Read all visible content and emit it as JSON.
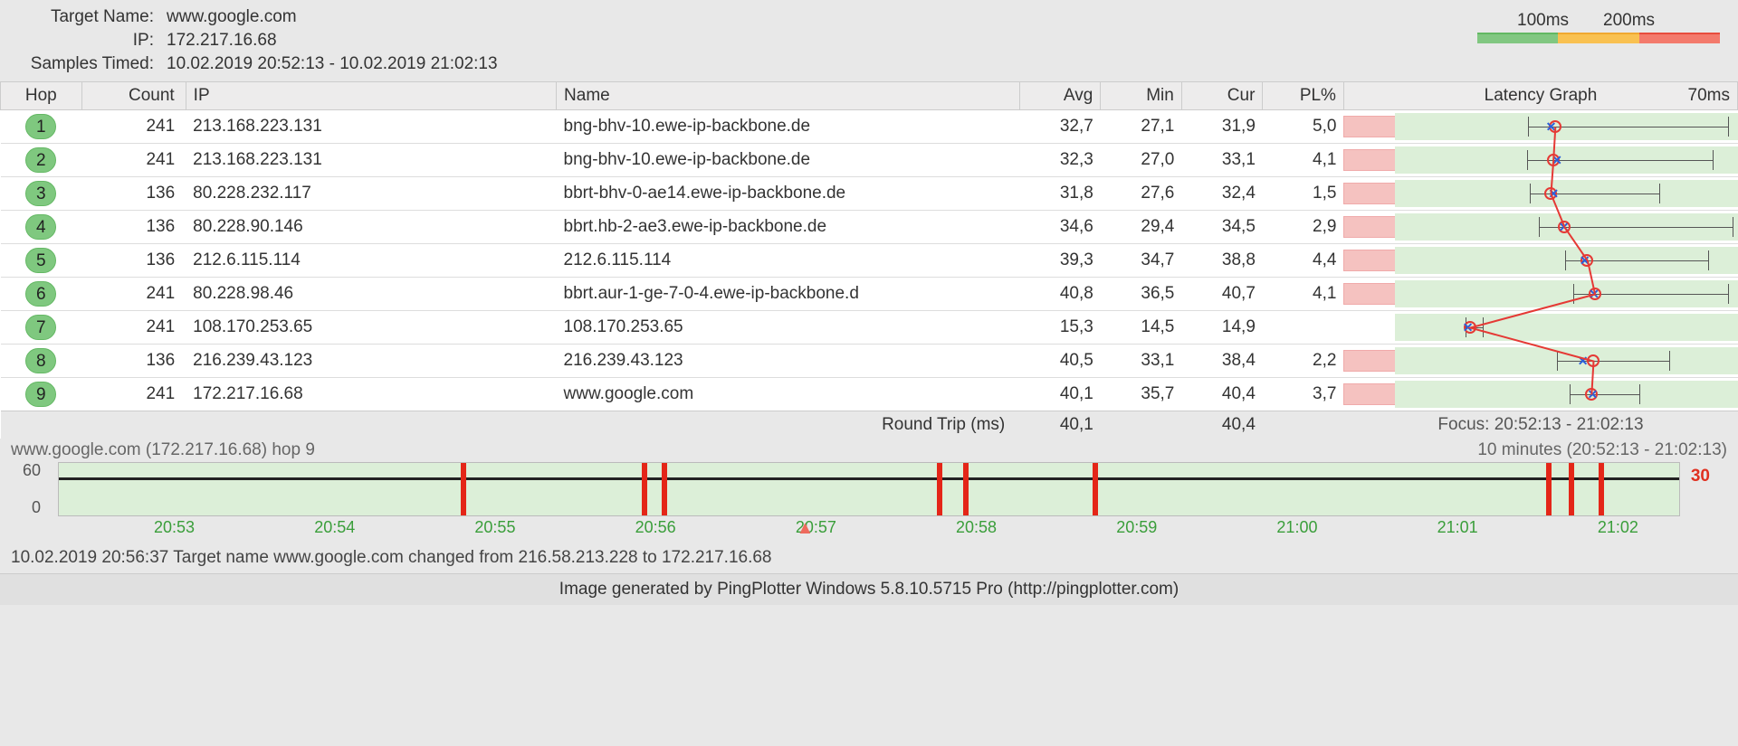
{
  "header": {
    "target_label": "Target Name:",
    "target_value": "www.google.com",
    "ip_label": "IP:",
    "ip_value": "172.217.16.68",
    "samples_label": "Samples Timed:",
    "samples_value": "10.02.2019 20:52:13 - 10.02.2019 21:02:13"
  },
  "legend": {
    "low": "100ms",
    "high": "200ms"
  },
  "columns": {
    "hop": "Hop",
    "count": "Count",
    "ip": "IP",
    "name": "Name",
    "avg": "Avg",
    "min": "Min",
    "cur": "Cur",
    "pl": "PL%",
    "graph": "Latency Graph",
    "graph_max": "70ms"
  },
  "graph_max_ms": 70,
  "hops": [
    {
      "hop": "1",
      "count": "241",
      "ip": "213.168.223.131",
      "name": "bng-bhv-10.ewe-ip-backbone.de",
      "avg": "32,7",
      "min": "27,1",
      "cur": "31,9",
      "pl": "5,0",
      "pl_pct": 5.0,
      "avg_ms": 32.7,
      "min_ms": 27.1,
      "cur_ms": 31.9,
      "max_ms": 68
    },
    {
      "hop": "2",
      "count": "241",
      "ip": "213.168.223.131",
      "name": "bng-bhv-10.ewe-ip-backbone.de",
      "avg": "32,3",
      "min": "27,0",
      "cur": "33,1",
      "pl": "4,1",
      "pl_pct": 4.1,
      "avg_ms": 32.3,
      "min_ms": 27.0,
      "cur_ms": 33.1,
      "max_ms": 65
    },
    {
      "hop": "3",
      "count": "136",
      "ip": "80.228.232.117",
      "name": "bbrt-bhv-0-ae14.ewe-ip-backbone.de",
      "avg": "31,8",
      "min": "27,6",
      "cur": "32,4",
      "pl": "1,5",
      "pl_pct": 1.5,
      "avg_ms": 31.8,
      "min_ms": 27.6,
      "cur_ms": 32.4,
      "max_ms": 54
    },
    {
      "hop": "4",
      "count": "136",
      "ip": "80.228.90.146",
      "name": "bbrt.hb-2-ae3.ewe-ip-backbone.de",
      "avg": "34,6",
      "min": "29,4",
      "cur": "34,5",
      "pl": "2,9",
      "pl_pct": 2.9,
      "avg_ms": 34.6,
      "min_ms": 29.4,
      "cur_ms": 34.5,
      "max_ms": 69
    },
    {
      "hop": "5",
      "count": "136",
      "ip": "212.6.115.114",
      "name": "212.6.115.114",
      "avg": "39,3",
      "min": "34,7",
      "cur": "38,8",
      "pl": "4,4",
      "pl_pct": 4.4,
      "avg_ms": 39.3,
      "min_ms": 34.7,
      "cur_ms": 38.8,
      "max_ms": 64
    },
    {
      "hop": "6",
      "count": "241",
      "ip": "80.228.98.46",
      "name": "bbrt.aur-1-ge-7-0-4.ewe-ip-backbone.d",
      "avg": "40,8",
      "min": "36,5",
      "cur": "40,7",
      "pl": "4,1",
      "pl_pct": 4.1,
      "avg_ms": 40.8,
      "min_ms": 36.5,
      "cur_ms": 40.7,
      "max_ms": 68
    },
    {
      "hop": "7",
      "count": "241",
      "ip": "108.170.253.65",
      "name": "108.170.253.65",
      "avg": "15,3",
      "min": "14,5",
      "cur": "14,9",
      "pl": "",
      "pl_pct": 0,
      "avg_ms": 15.3,
      "min_ms": 14.5,
      "cur_ms": 14.9,
      "max_ms": 18
    },
    {
      "hop": "8",
      "count": "136",
      "ip": "216.239.43.123",
      "name": "216.239.43.123",
      "avg": "40,5",
      "min": "33,1",
      "cur": "38,4",
      "pl": "2,2",
      "pl_pct": 2.2,
      "avg_ms": 40.5,
      "min_ms": 33.1,
      "cur_ms": 38.4,
      "max_ms": 56
    },
    {
      "hop": "9",
      "count": "241",
      "ip": "172.217.16.68",
      "name": "www.google.com",
      "avg": "40,1",
      "min": "35,7",
      "cur": "40,4",
      "pl": "3,7",
      "pl_pct": 3.7,
      "avg_ms": 40.1,
      "min_ms": 35.7,
      "cur_ms": 40.4,
      "max_ms": 50
    }
  ],
  "summary": {
    "label": "Round Trip (ms)",
    "avg": "40,1",
    "cur": "40,4",
    "focus": "Focus: 20:52:13 - 21:02:13"
  },
  "timechart": {
    "title_left": "www.google.com (172.217.16.68) hop 9",
    "title_right": "10 minutes (20:52:13 - 21:02:13)",
    "y_top": "60",
    "y_bottom": "0",
    "loss_max": "30",
    "loss_positions_pct": [
      24.8,
      36.0,
      37.2,
      54.2,
      55.8,
      63.8,
      91.8,
      93.2,
      95.0
    ],
    "ticks": [
      "20:53",
      "20:54",
      "20:55",
      "20:56",
      "20:57",
      "20:58",
      "20:59",
      "21:00",
      "21:01",
      "21:02"
    ],
    "marker_pct": 45.5
  },
  "footer": {
    "log": "10.02.2019 20:56:37 Target name www.google.com changed from 216.58.213.228 to 172.217.16.68",
    "credit": "Image generated by PingPlotter Windows 5.8.10.5715 Pro (http://pingplotter.com)"
  },
  "chart_data": {
    "type": "line",
    "title": "Latency Graph",
    "xlabel": "Hop",
    "ylabel": "ms",
    "ylim": [
      0,
      70
    ],
    "series": [
      {
        "name": "Avg",
        "values": [
          32.7,
          32.3,
          31.8,
          34.6,
          39.3,
          40.8,
          15.3,
          40.5,
          40.1
        ]
      },
      {
        "name": "Min",
        "values": [
          27.1,
          27.0,
          27.6,
          29.4,
          34.7,
          36.5,
          14.5,
          33.1,
          35.7
        ]
      },
      {
        "name": "Cur",
        "values": [
          31.9,
          33.1,
          32.4,
          34.5,
          38.8,
          40.7,
          14.9,
          38.4,
          40.4
        ]
      },
      {
        "name": "PL%",
        "values": [
          5.0,
          4.1,
          1.5,
          2.9,
          4.4,
          4.1,
          0,
          2.2,
          3.7
        ]
      }
    ],
    "categories": [
      "1",
      "2",
      "3",
      "4",
      "5",
      "6",
      "7",
      "8",
      "9"
    ]
  }
}
